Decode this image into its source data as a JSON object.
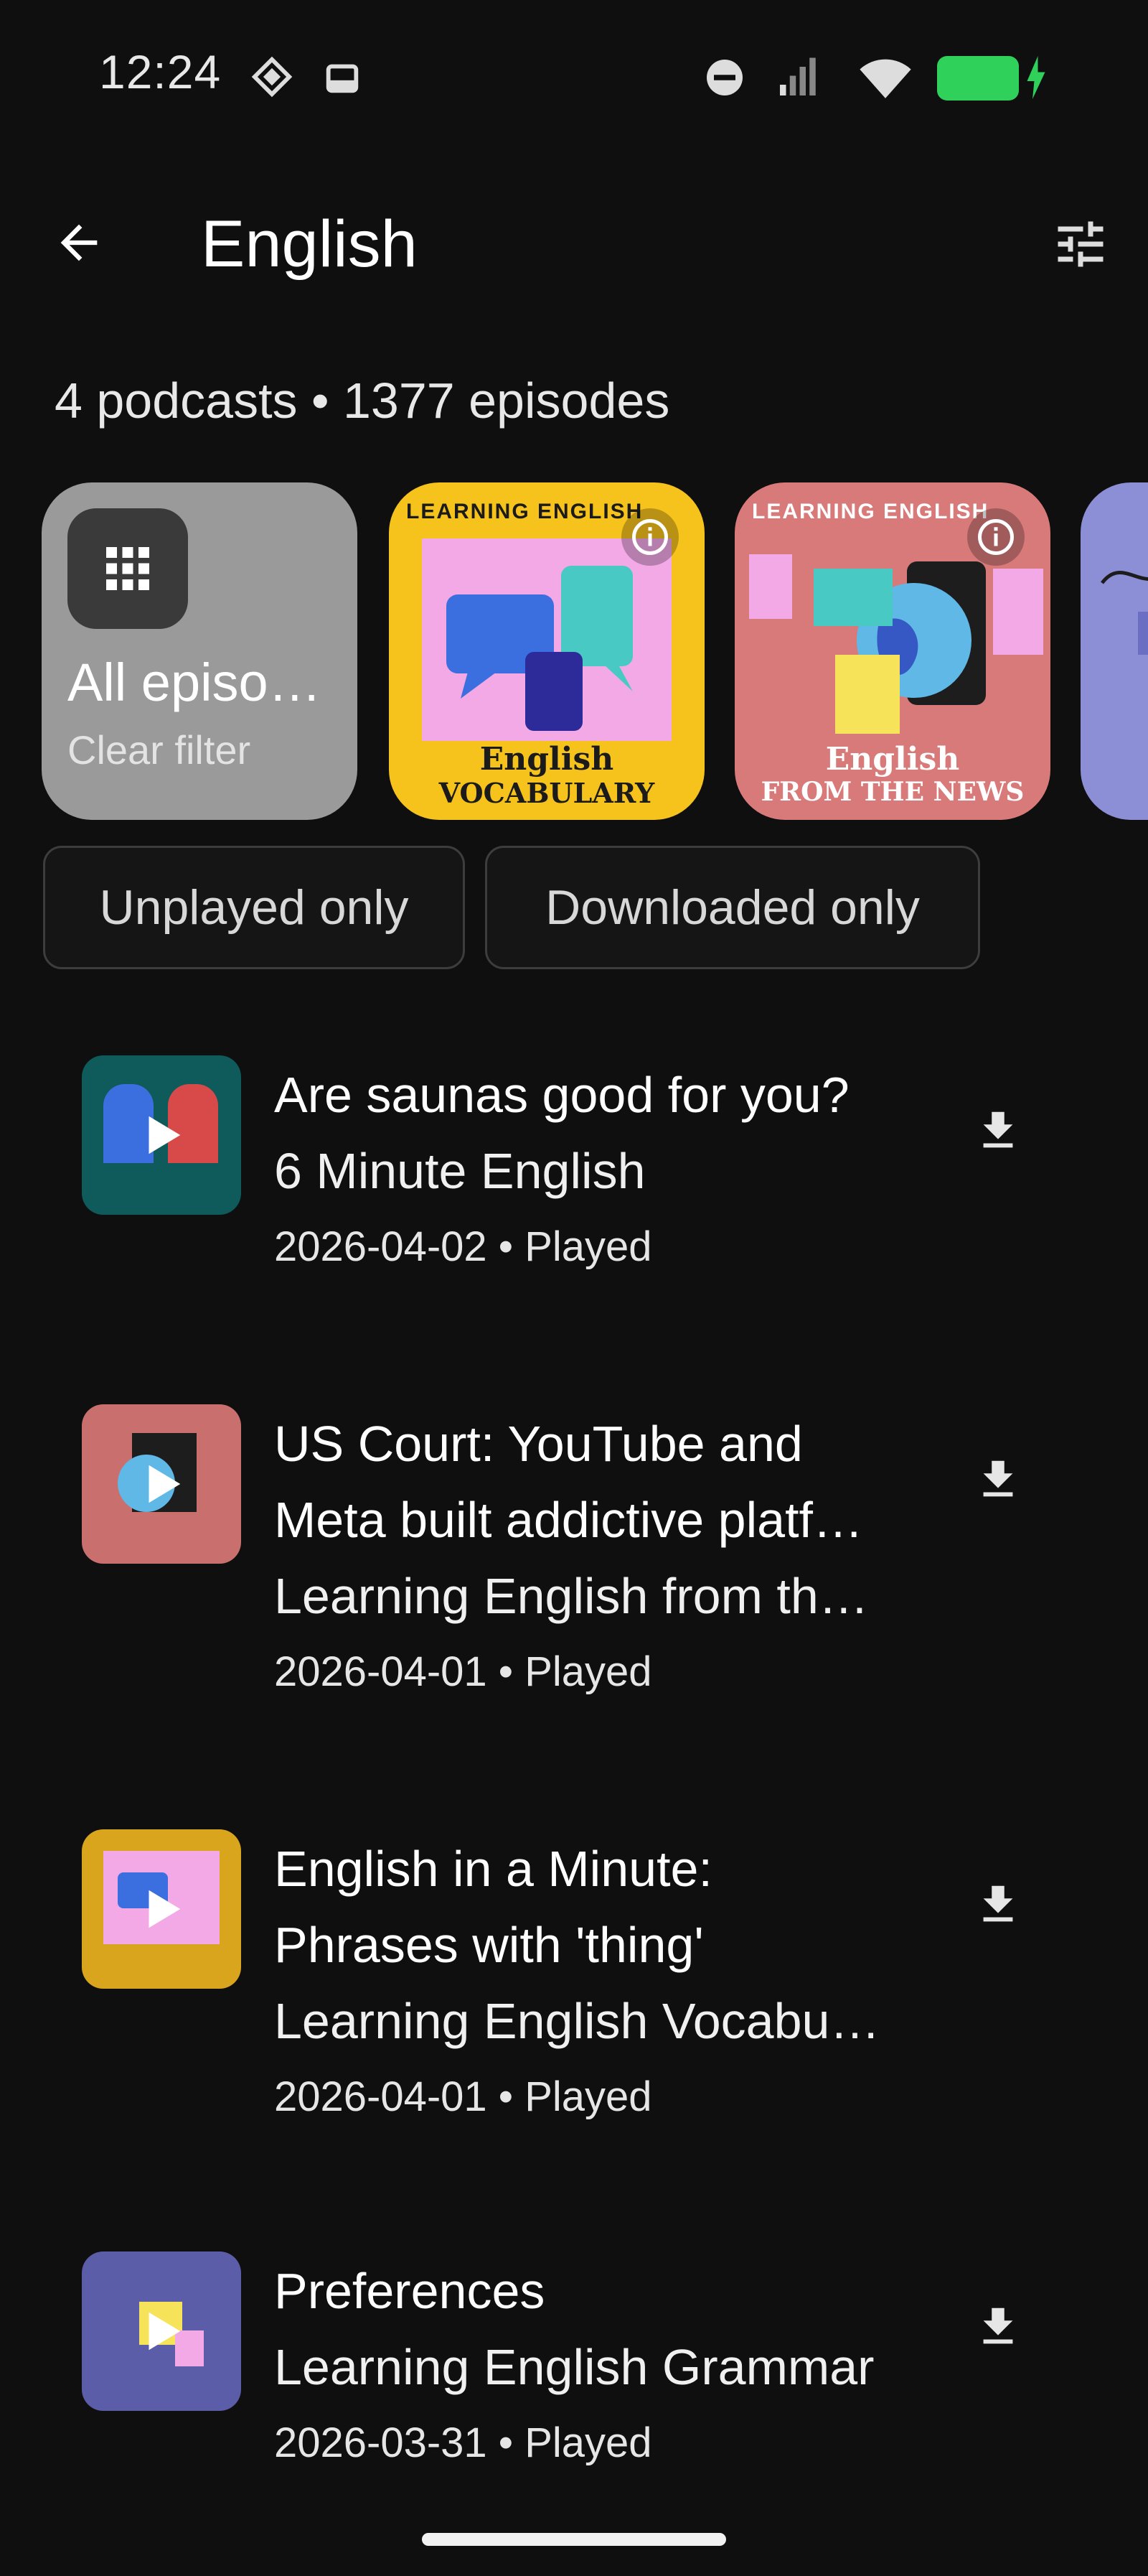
{
  "status_bar": {
    "time": "12:24"
  },
  "header": {
    "title": "English"
  },
  "summary": "4 podcasts • 1377 episodes",
  "podcasts": {
    "all": {
      "label": "All episo…",
      "sub": "Clear filter"
    },
    "items": [
      {
        "brand": "LEARNING ENGLISH",
        "line1": "English",
        "line2": "VOCABULARY",
        "bg": "#f6c21c"
      },
      {
        "brand": "LEARNING ENGLISH",
        "line1": "English",
        "line2": "FROM THE NEWS",
        "bg": "#d87a7a"
      },
      {
        "bg": "#8c8fd6"
      }
    ]
  },
  "filters": [
    "Unplayed only",
    "Downloaded only"
  ],
  "episodes": [
    {
      "title": "Are saunas good for you?",
      "podcast": "6 Minute English",
      "meta": "2026-04-02 • Played",
      "thumb_bg": "#0f5a5a"
    },
    {
      "title": "US Court: YouTube and Meta built addictive platf…",
      "podcast": "Learning English from th…",
      "meta": "2026-04-01 • Played",
      "thumb_bg": "#c9706f"
    },
    {
      "title": "English in a Minute: Phrases with 'thing'",
      "podcast": "Learning English Vocabu…",
      "meta": "2026-04-01 • Played",
      "thumb_bg": "#d9a51c"
    },
    {
      "title": "Preferences",
      "podcast": "Learning English Grammar",
      "meta": "2026-03-31 • Played",
      "thumb_bg": "#5c5da8"
    }
  ],
  "colors": {
    "background": "#0f0f10",
    "battery": "#2fd15a"
  }
}
